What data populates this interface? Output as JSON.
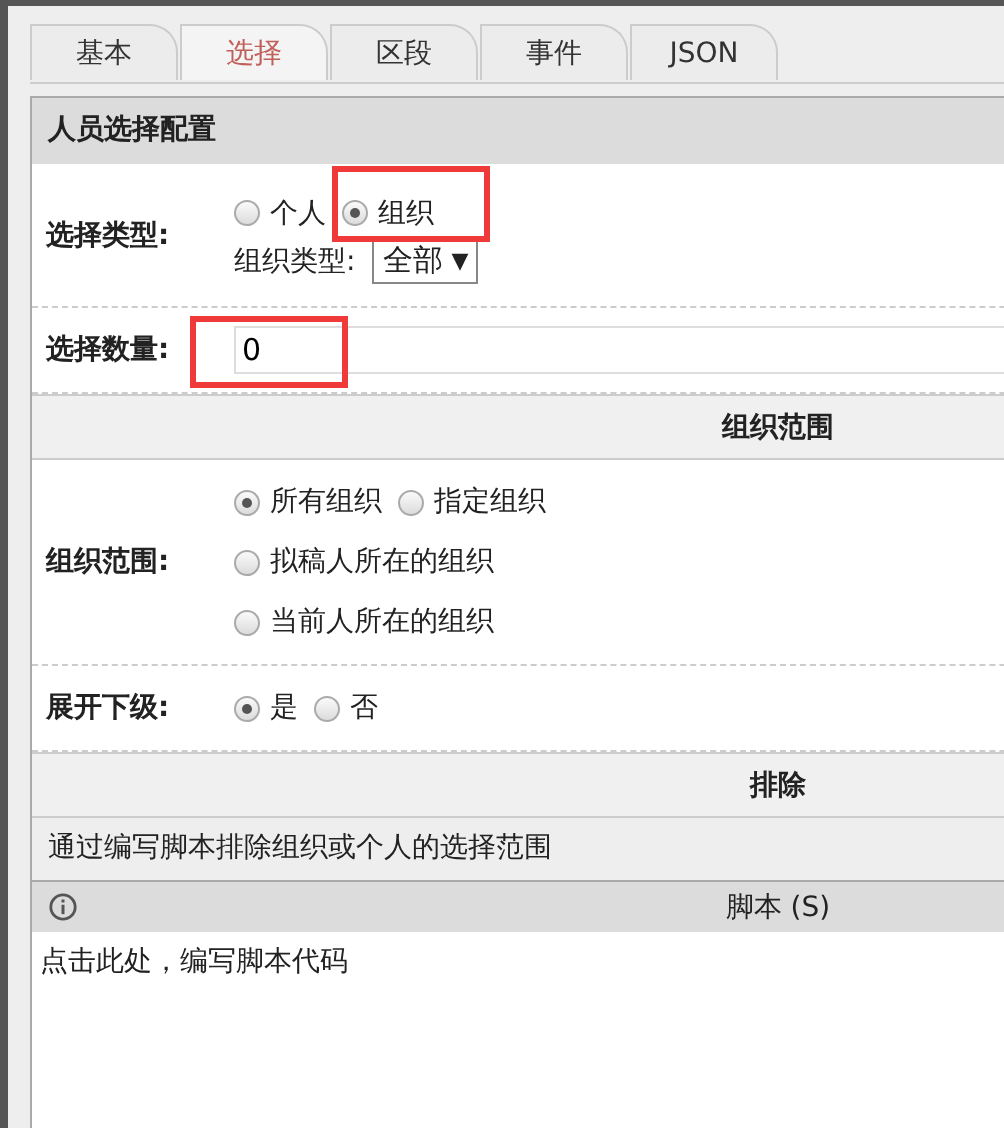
{
  "tabs": [
    {
      "label": "基本",
      "selected": false
    },
    {
      "label": "选择",
      "selected": true
    },
    {
      "label": "区段",
      "selected": false
    },
    {
      "label": "事件",
      "selected": false
    },
    {
      "label": "JSON",
      "selected": false
    }
  ],
  "sections": [
    {
      "kind": "config",
      "title": "人员选择配置",
      "rows": [
        {
          "kind": "select_type",
          "label": "选择类型:",
          "options": [
            {
              "label": "个人",
              "selected": false,
              "highlighted": false
            },
            {
              "label": "组织",
              "selected": true,
              "highlighted": true
            }
          ],
          "org_type": {
            "label": "组织类型:",
            "value": "全部",
            "arrow": "▼"
          }
        },
        {
          "kind": "count",
          "label": "选择数量:",
          "value": "0",
          "highlighted": true
        }
      ]
    },
    {
      "kind": "group",
      "title": "组织范围",
      "rows": [
        {
          "kind": "radios",
          "label": "组织范围:",
          "lines": [
            [
              {
                "label": "所有组织",
                "selected": true
              },
              {
                "label": "指定组织",
                "selected": false
              }
            ],
            [
              {
                "label": "拟稿人所在的组织",
                "selected": false
              }
            ],
            [
              {
                "label": "当前人所在的组织",
                "selected": false
              }
            ]
          ]
        },
        {
          "kind": "radios",
          "label": "展开下级:",
          "lines": [
            [
              {
                "label": "是",
                "selected": true
              },
              {
                "label": "否",
                "selected": false
              }
            ]
          ]
        }
      ]
    },
    {
      "kind": "exclude",
      "title": "排除",
      "description": "通过编写脚本排除组织或个人的选择范围",
      "script": {
        "title": "脚本 (S)",
        "placeholder": "点击此处，编写脚本代码"
      }
    }
  ]
}
